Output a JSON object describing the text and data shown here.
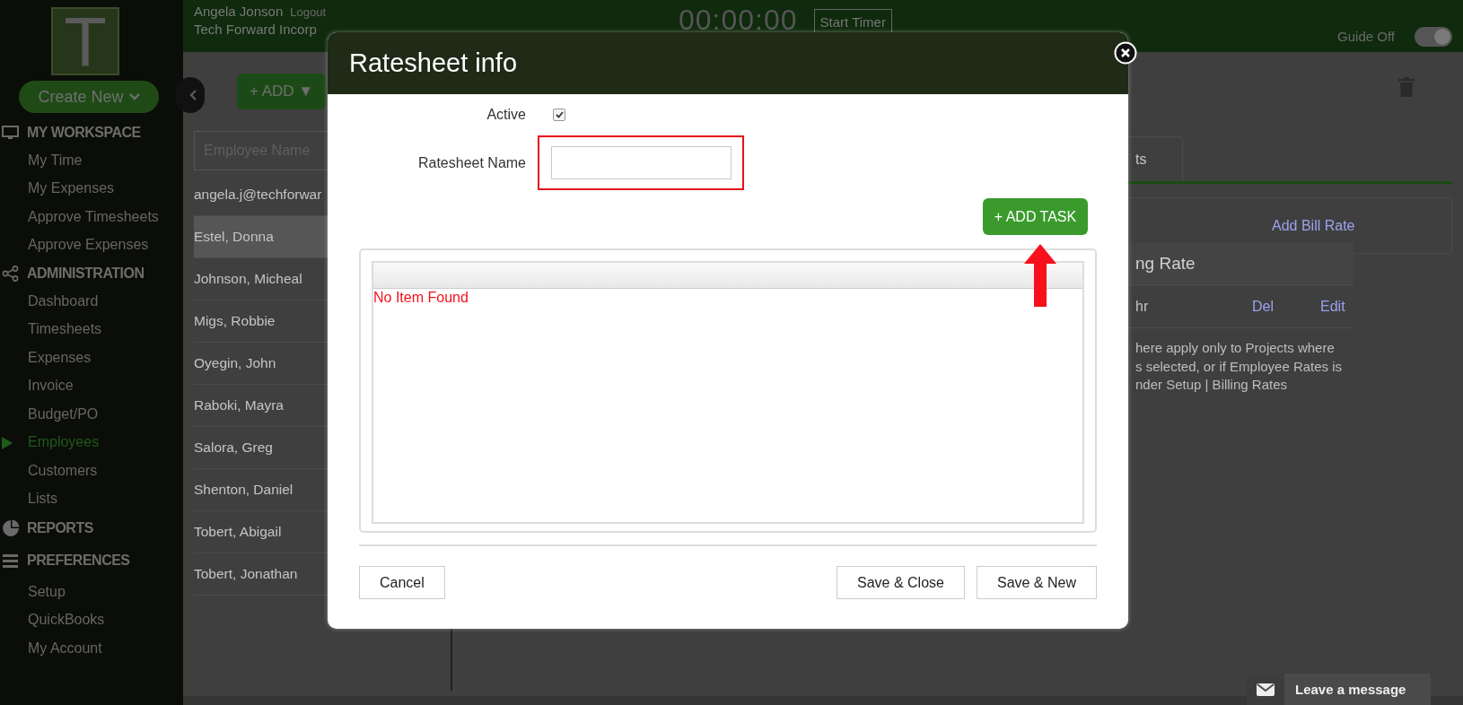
{
  "sidebar": {
    "logo_letter": "T",
    "create_button": "Create New",
    "sections": [
      {
        "title": "MY WORKSPACE",
        "kind": "monitor",
        "items": [
          {
            "label": "My Time",
            "selected": false
          },
          {
            "label": "My Expenses",
            "selected": false
          },
          {
            "label": "Approve Timesheets",
            "selected": false
          },
          {
            "label": "Approve Expenses",
            "selected": false
          }
        ]
      },
      {
        "title": "ADMINISTRATION",
        "kind": "share",
        "items": [
          {
            "label": "Dashboard",
            "selected": false
          },
          {
            "label": "Timesheets",
            "selected": false
          },
          {
            "label": "Expenses",
            "selected": false
          },
          {
            "label": "Invoice",
            "selected": false
          },
          {
            "label": "Budget/PO",
            "selected": false
          },
          {
            "label": "Employees",
            "selected": true
          },
          {
            "label": "Customers",
            "selected": false
          },
          {
            "label": "Lists",
            "selected": false
          }
        ]
      },
      {
        "title": "REPORTS",
        "kind": "pie"
      },
      {
        "title": "PREFERENCES",
        "kind": "sliders",
        "items": [
          {
            "label": "Setup",
            "selected": false
          },
          {
            "label": "QuickBooks",
            "selected": false
          },
          {
            "label": "My Account",
            "selected": false
          }
        ]
      }
    ]
  },
  "header": {
    "user": "Angela Jonson",
    "logout": "Logout",
    "company": "Tech Forward Incorp",
    "timer": "00:00:00",
    "timer_button": "Start Timer",
    "guide": "Guide Off",
    "guide_toggle_on": true
  },
  "toolbar": {
    "add_button": "+ ADD ▼"
  },
  "employees": {
    "search_placeholder": "Employee Name",
    "rows": [
      {
        "name": "angela.j@techforwar",
        "selected": false
      },
      {
        "name": "Estel, Donna",
        "selected": true
      },
      {
        "name": "Johnson, Micheal",
        "selected": false
      },
      {
        "name": "Migs, Robbie",
        "selected": false
      },
      {
        "name": "Oyegin, John",
        "selected": false
      },
      {
        "name": "Raboki, Mayra",
        "selected": false
      },
      {
        "name": "Salora, Greg",
        "selected": false
      },
      {
        "name": "Shenton, Daniel",
        "selected": false
      },
      {
        "name": "Tobert, Abigail",
        "selected": false
      },
      {
        "name": "Tobert, Jonathan",
        "selected": false
      }
    ]
  },
  "detail": {
    "tab": "ts",
    "add_link": "Add Bill Rate",
    "table_header": "ng Rate",
    "row": {
      "column_1": "hr",
      "delete": "Del",
      "edit": "Edit"
    },
    "note_lines": [
      "here apply only to Projects where",
      "s selected, or if Employee Rates is",
      "nder Setup | Billing Rates"
    ]
  },
  "modal": {
    "title": "Ratesheet info",
    "active_label": "Active",
    "active": true,
    "name_label": "Ratesheet Name",
    "add_task": "+ ADD TASK",
    "empty_text": "No Item Found",
    "buttons": {
      "cancel": "Cancel",
      "save_close": "Save & Close",
      "save_new": "Save & New"
    }
  },
  "chat": {
    "label": "Leave a message"
  }
}
